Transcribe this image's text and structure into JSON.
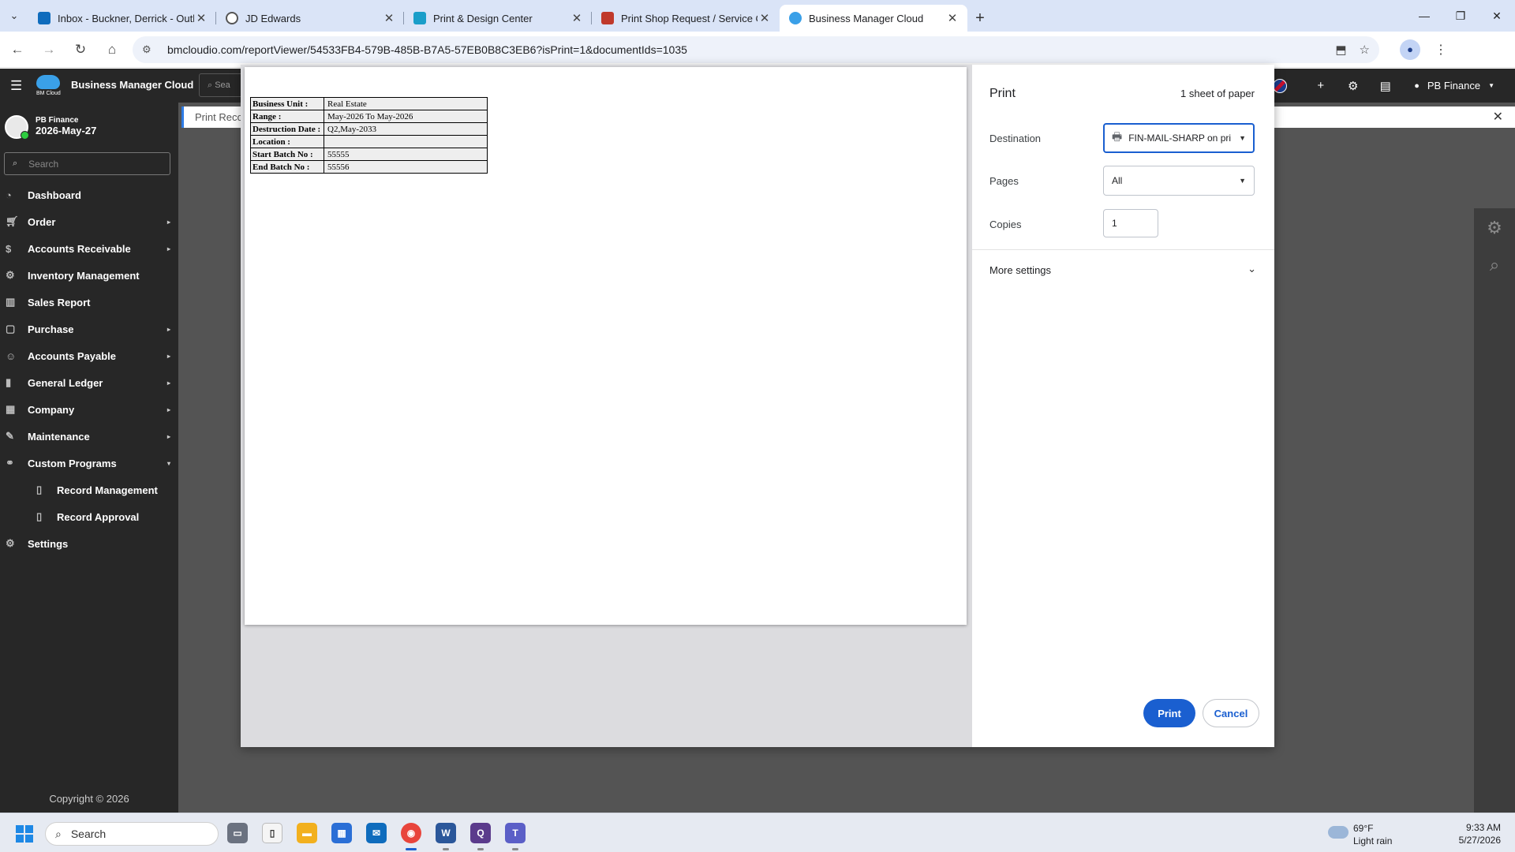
{
  "browser": {
    "tabs": [
      {
        "title": "Inbox - Buckner, Derrick - Outlo",
        "color": "#0f6cbd"
      },
      {
        "title": "JD Edwards",
        "color": "#555555"
      },
      {
        "title": "Print & Design Center",
        "color": "#1a9ec9"
      },
      {
        "title": "Print Shop Request / Service Ca",
        "color": "#c0392b"
      },
      {
        "title": "Business Manager Cloud",
        "color": "#3aa0e8"
      }
    ],
    "url": "bmcloudio.com/reportViewer/54533FB4-579B-485B-B7A5-57EB0B8C3EB6?isPrint=1&documentIds=1035"
  },
  "app": {
    "brand": "Business Manager Cloud",
    "logo_text": "BM Cloud",
    "header_search_placeholder": "Sea",
    "header_user": "PB Finance",
    "sidebar_user": "PB Finance",
    "sidebar_date": "2026-May-27",
    "sidebar_search_placeholder": "Search",
    "menu": [
      {
        "label": "Dashboard",
        "icon": "dashboard-icon"
      },
      {
        "label": "Order",
        "icon": "cart-icon"
      },
      {
        "label": "Accounts Receivable",
        "icon": "dollar-icon"
      },
      {
        "label": "Inventory Management",
        "icon": "inventory-icon"
      },
      {
        "label": "Sales Report",
        "icon": "chart-icon"
      },
      {
        "label": "Purchase",
        "icon": "bag-icon"
      },
      {
        "label": "Accounts Payable",
        "icon": "users-icon"
      },
      {
        "label": "General Ledger",
        "icon": "book-icon"
      },
      {
        "label": "Company",
        "icon": "building-icon"
      },
      {
        "label": "Maintenance",
        "icon": "wrench-icon"
      },
      {
        "label": "Custom Programs",
        "icon": "network-icon"
      },
      {
        "label": "Record Management",
        "icon": "file-icon"
      },
      {
        "label": "Record Approval",
        "icon": "file-icon"
      },
      {
        "label": "Settings",
        "icon": "gear-icon"
      }
    ],
    "copyright": "Copyright © 2026",
    "breadcrumb": "Print Reco"
  },
  "report": {
    "rows": [
      {
        "key": "Business Unit :",
        "value": "Real Estate"
      },
      {
        "key": "Range :",
        "value": "May-2026 To May-2026"
      },
      {
        "key": "Destruction Date :",
        "value": "Q2,May-2033"
      },
      {
        "key": "Location :",
        "value": ""
      },
      {
        "key": "Start Batch No :",
        "value": "55555"
      },
      {
        "key": "End Batch No :",
        "value": "55556"
      }
    ]
  },
  "print": {
    "title": "Print",
    "sheets": "1 sheet of paper",
    "destination_label": "Destination",
    "destination_value": "FIN-MAIL-SHARP on pri",
    "pages_label": "Pages",
    "pages_value": "All",
    "copies_label": "Copies",
    "copies_value": "1",
    "more_settings": "More settings",
    "print_button": "Print",
    "cancel_button": "Cancel",
    "accent": "#1a5fd0"
  },
  "taskbar": {
    "search": "Search",
    "temp": "69°F",
    "weather": "Light rain",
    "time": "9:33 AM",
    "date": "5/27/2026"
  }
}
